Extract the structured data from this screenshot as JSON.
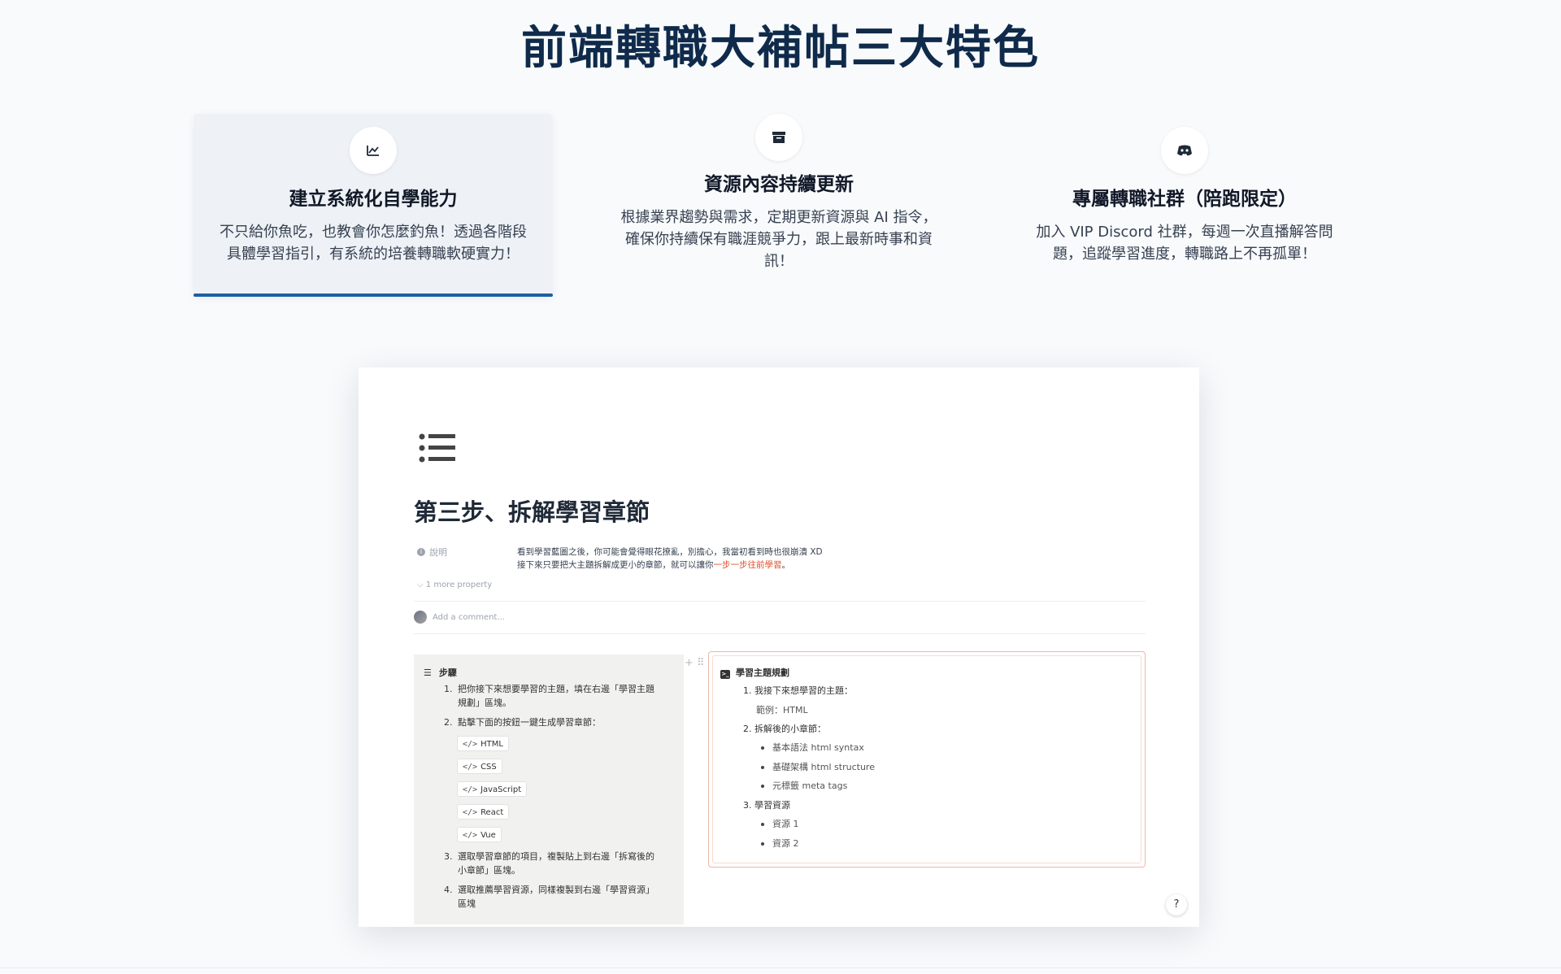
{
  "page": {
    "title": "前端轉職大補帖三大特色"
  },
  "features": [
    {
      "icon": "chart-line-icon",
      "title": "建立系統化自學能力",
      "desc_line1": "不只給你魚吃，也教會你怎麼釣魚！透過各階段",
      "desc_line2": "具體學習指引，有系統的培養轉職軟硬實力！"
    },
    {
      "icon": "archive-box-icon",
      "title": "資源內容持續更新",
      "desc_line1": "根據業界趨勢與需求，定期更新資源與 AI 指令，",
      "desc_line2": "確保你持續保有職涯競爭力，跟上最新時事和資",
      "desc_line3": "訊！"
    },
    {
      "icon": "discord-icon",
      "title": "專屬轉職社群（陪跑限定）",
      "desc_line1": "加入 VIP Discord 社群，每週一次直播解答問",
      "desc_line2": "題，追蹤學習進度，轉職路上不再孤單！"
    }
  ],
  "notion": {
    "title": "第三步、拆解學習章節",
    "property_label": "說明",
    "property_line1": "看到學習藍圖之後，你可能會覺得眼花撩亂，別擔心，我當初看到時也很崩潰 XD",
    "property_line2_a": "接下來只要把大主題拆解成更小的章節，就可以讓你",
    "property_line2_red": "一步一步往前學習",
    "property_line2_b": "。",
    "more_property": "1 more property",
    "comment_placeholder": "Add a comment...",
    "steps": {
      "heading": "步驟",
      "s1_num": "1.",
      "s1_line1": "把你接下來想要學習的主題，填在右邊「學習主題",
      "s1_line2": "規劃」區塊。",
      "s2_num": "2.",
      "s2_line1": "點擊下面的按鈕一鍵生成學習章節：",
      "buttons": [
        "HTML",
        "CSS",
        "JavaScript",
        "React",
        "Vue"
      ],
      "s3_num": "3.",
      "s3_line1": "選取學習章節的項目，複製貼上到右邊「拆寫後的",
      "s3_line2": "小章節」區塊。",
      "s4_num": "4.",
      "s4_line1": "選取推薦學習資源，同樣複製到右邊「學習資源」",
      "s4_line2": "區塊"
    },
    "plan": {
      "heading": "學習主題規劃",
      "i1_num": "1.",
      "i1": "我接下來想學習的主題：",
      "i1_example": "範例：HTML",
      "i2_num": "2.",
      "i2": "拆解後的小章節：",
      "i2_bullets": [
        "基本語法 html syntax",
        "基礎架構 html structure",
        "元標籤 meta tags"
      ],
      "i3_num": "3.",
      "i3": "學習資源",
      "i3_bullets": [
        "資源 1",
        "資源 2"
      ]
    },
    "help_label": "?"
  },
  "colors": {
    "title": "#0f2a4a",
    "accent": "#1d5fa3",
    "highlight_red": "#e0502c"
  }
}
